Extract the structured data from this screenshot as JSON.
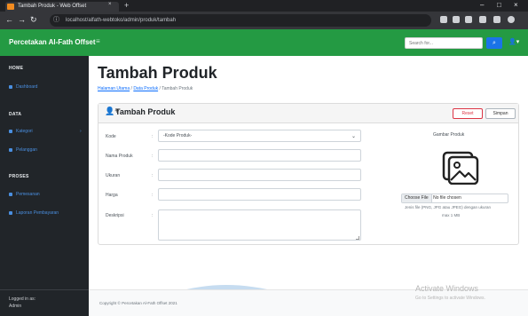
{
  "browser": {
    "tab_title": "Tambah Produk - Web Offset",
    "tab_close": "×",
    "new_tab": "+",
    "url_lock": "ⓘ",
    "url": "localhost/alfath-webtoko/admin/produk/tambah",
    "nav": {
      "back": "←",
      "forward": "→",
      "reload": "↻"
    },
    "window": {
      "minimize": "–",
      "maximize": "□",
      "close": "×"
    }
  },
  "navbar": {
    "brand": "Percetakan Al-Fath Offset",
    "toggle": "≡",
    "search_placeholder": "Search for...",
    "search_icon": "⌕",
    "user_icon": "👤▾"
  },
  "sidebar": {
    "sections": [
      {
        "heading": "HOME",
        "items": [
          {
            "label": "Dashboard",
            "icon": "tachometer-icon"
          }
        ]
      },
      {
        "heading": "DATA",
        "items": [
          {
            "label": "Kategori",
            "icon": "columns-icon"
          },
          {
            "label": "Pelanggan",
            "icon": "table-icon"
          }
        ]
      },
      {
        "heading": "PROSES",
        "items": [
          {
            "label": "Pemesanan",
            "icon": "chart-icon"
          },
          {
            "label": "Laporan Pembayaran",
            "icon": "report-icon"
          }
        ]
      }
    ],
    "caret": "›",
    "footer": {
      "line1": "Logged in as:",
      "line2": "Admin"
    }
  },
  "page": {
    "title": "Tambah Produk",
    "breadcrumb": [
      {
        "label": "Halaman Utama",
        "link": true
      },
      {
        "label": "Data Produk",
        "link": true
      },
      {
        "label": "Tambah Produk",
        "link": false
      }
    ],
    "separator": "/"
  },
  "card": {
    "icon": "👤+",
    "title": "Tambah Produk",
    "reset_label": "Reset",
    "save_label": "Simpan",
    "fields": [
      {
        "label": "Kode",
        "colon": ":",
        "value": "-Kode Produk-"
      },
      {
        "label": "Nama Produk",
        "colon": ":",
        "value": ""
      },
      {
        "label": "Ukuran",
        "colon": ":",
        "value": ""
      },
      {
        "label": "Harga",
        "colon": ":",
        "value": ""
      },
      {
        "label": "Deskripsi",
        "colon": ":",
        "value": ""
      }
    ],
    "select_caret": "⌄",
    "image": {
      "label": "Gambar Produk",
      "choose_label": "Choose File",
      "file_status": "No file chosen",
      "help1": "Jenis file (PNG, JPG atau JPEG) dengan ukuran",
      "help2": "max 1 MB"
    }
  },
  "footer": {
    "copyright": "Copyright © Percetakan Al-Fath Offset 2021"
  },
  "activation": {
    "title": "Activate Windows",
    "subtitle": "Go to Settings to activate Windows."
  }
}
